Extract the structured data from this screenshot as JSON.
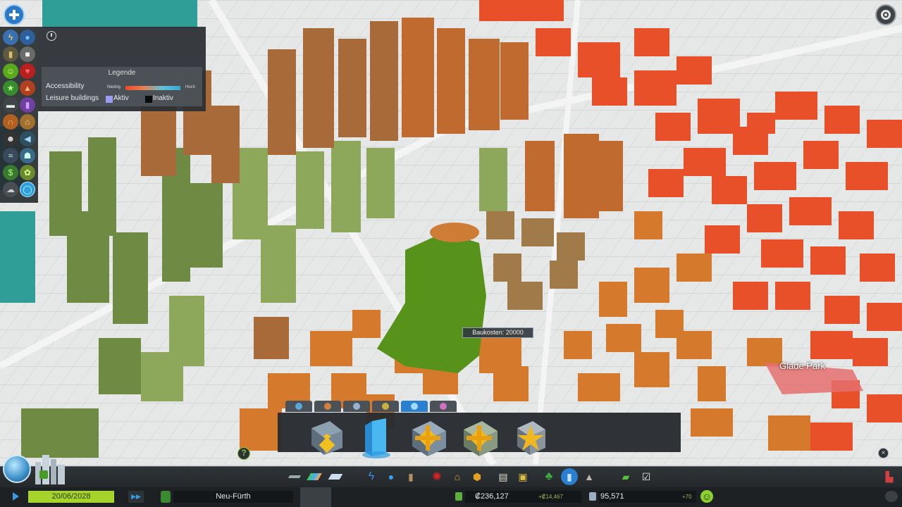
{
  "legend": {
    "title": "Legende",
    "accessibility_label": "Accessibility",
    "low_label": "Niedrig",
    "high_label": "Hoch",
    "leisure_label": "Leisure buildings",
    "active_label": "Aktiv",
    "inactive_label": "Inaktiv",
    "colors": {
      "low": "#e84a2a",
      "high": "#3aa8d0",
      "active": "#9b9df0",
      "inactive": "#0b0b0b"
    }
  },
  "map": {
    "cost_tooltip": "Baukosten: 20000",
    "park_label": "Glade Park"
  },
  "status": {
    "date": "20/06/2028",
    "city_name": "Neu-Fürth",
    "money": "₡236,127",
    "income": "+₡14,467",
    "population": "95,571",
    "population_change": "+70"
  },
  "icons": {
    "toolbar_toggle": "toolbar-toggle-icon",
    "settings": "gear-icon",
    "help": "?",
    "close": "×"
  },
  "building_tabs": [
    "tab-1",
    "tab-2",
    "tab-3",
    "tab-4",
    "tab-5",
    "tab-6"
  ],
  "active_tab_index": 4
}
